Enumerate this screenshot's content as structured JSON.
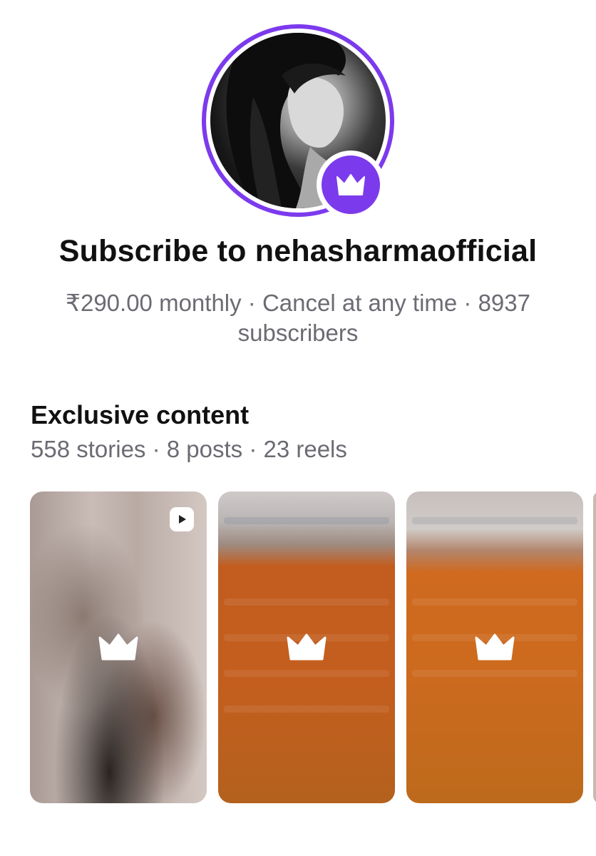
{
  "profile": {
    "title": "Subscribe to nehasharmaofficial",
    "meta_line": "₹290.00 monthly · Cancel at any time · 8937 subscribers"
  },
  "exclusive": {
    "heading": "Exclusive content",
    "counts": "558 stories · 8 posts · 23 reels"
  },
  "colors": {
    "accent": "#7c3aed",
    "text_primary": "#111111",
    "text_secondary": "#6b6b73"
  },
  "cards": [
    {
      "type": "reel",
      "icon": "crown-icon",
      "badge_icon": "play-icon"
    },
    {
      "type": "post",
      "icon": "crown-icon"
    },
    {
      "type": "post",
      "icon": "crown-icon"
    }
  ]
}
